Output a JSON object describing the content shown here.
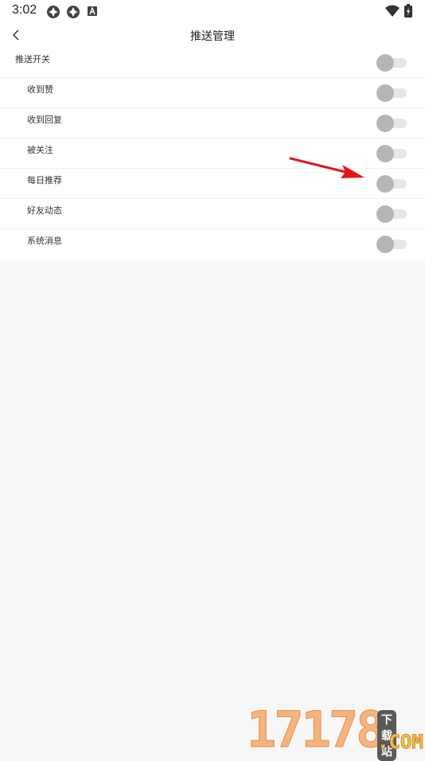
{
  "status_bar": {
    "time": "3:02",
    "icons": [
      "app-notification-icon",
      "app-notification-icon",
      "a-letter-icon",
      "wifi-icon",
      "battery-charging-icon"
    ]
  },
  "header": {
    "title": "推送管理",
    "back_icon": "chevron-left-icon"
  },
  "settings": {
    "master": {
      "label": "推送开关",
      "enabled": false
    },
    "items": [
      {
        "label": "收到赞",
        "enabled": false
      },
      {
        "label": "收到回复",
        "enabled": false
      },
      {
        "label": "被关注",
        "enabled": false
      },
      {
        "label": "每日推荐",
        "enabled": false
      },
      {
        "label": "好友动态",
        "enabled": false
      },
      {
        "label": "系统消息",
        "enabled": false
      }
    ]
  },
  "annotation": {
    "type": "red-arrow-icon",
    "color": "#e3161c",
    "target": "每日推荐"
  },
  "watermark": {
    "digits": "17178",
    "tag": "下载站",
    "domain": ".COM"
  },
  "colors": {
    "toggle_knob_off": "#b5b5b5",
    "toggle_track_off": "#e6e6e6",
    "background": "#f7f7f7"
  }
}
